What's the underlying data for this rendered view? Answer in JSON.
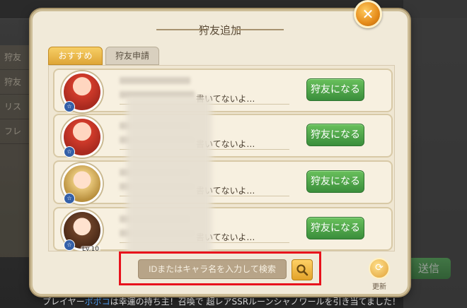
{
  "background": {
    "side_items": [
      "狩友",
      "狩友",
      "リス",
      "フレ"
    ],
    "send_label": "送信",
    "chat_prefix": "プレイヤー",
    "chat_name": "ポポコ",
    "chat_suffix": "は幸運の持ち主！召喚で 超レアSSRルーンシャノワールを引き当てました！"
  },
  "dialog": {
    "title": "狩友追加",
    "close_icon": "close-icon",
    "tabs": [
      {
        "label": "おすすめ",
        "active": true
      },
      {
        "label": "狩友申請",
        "active": false
      }
    ],
    "cards": [
      {
        "avatar": "boy",
        "badge": "☆",
        "level": "",
        "comment": "書いてないよ…",
        "button": "狩友になる"
      },
      {
        "avatar": "boy",
        "badge": "☆",
        "level": "",
        "comment": "書いてないよ…",
        "button": "狩友になる"
      },
      {
        "avatar": "girl-green",
        "badge": "☆",
        "level": "",
        "comment": "書いてないよ…",
        "button": "狩友になる"
      },
      {
        "avatar": "girl-brown",
        "badge": "☆",
        "level": "Lv.10",
        "comment": "書いてないよ…",
        "button": "狩友になる"
      }
    ],
    "search": {
      "placeholder": "IDまたはキャラ名を入力して検索",
      "button_icon": "search-icon"
    },
    "refresh_label": "更新"
  }
}
